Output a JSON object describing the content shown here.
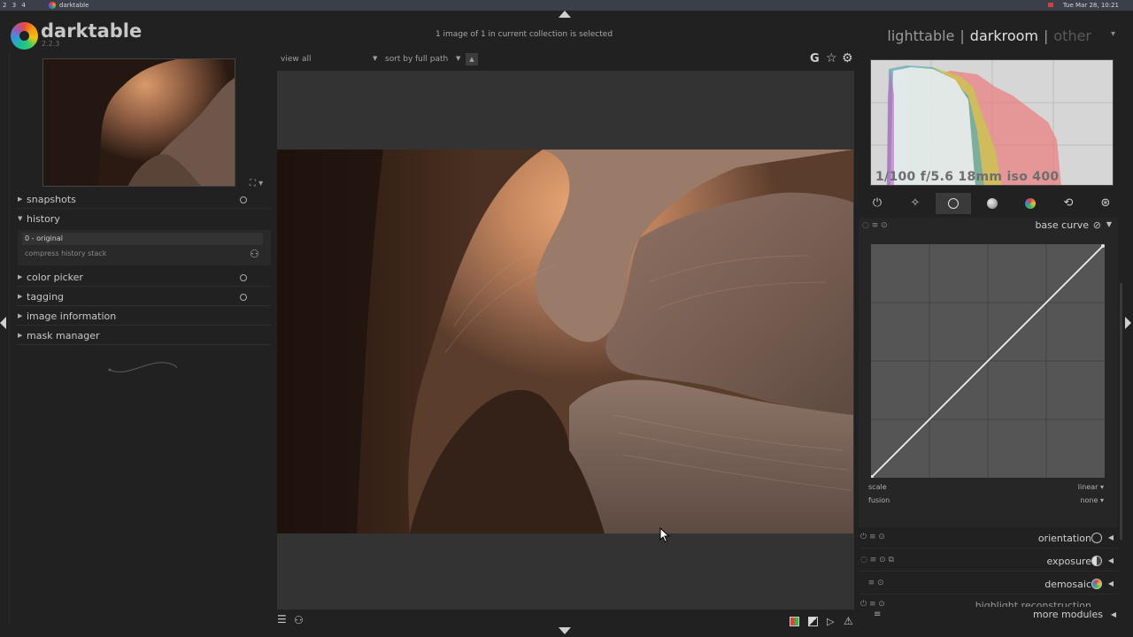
{
  "os": {
    "workspaces": [
      "2",
      "3",
      "4"
    ],
    "app_name": "darktable",
    "clock": "Tue Mar 28, 10:21"
  },
  "header": {
    "title": "darktable",
    "version": "2.2.3",
    "collection_info": "1 image of 1 in current collection is selected",
    "views": {
      "lighttable": "lighttable",
      "darkroom": "darkroom",
      "other": "other",
      "separator": "|"
    }
  },
  "left_panel": {
    "modules": [
      {
        "label": "snapshots",
        "expanded": false
      },
      {
        "label": "history",
        "expanded": true
      },
      {
        "label": "color picker",
        "expanded": false
      },
      {
        "label": "tagging",
        "expanded": false
      },
      {
        "label": "image information",
        "expanded": false
      },
      {
        "label": "mask manager",
        "expanded": false
      }
    ],
    "history": {
      "items": [
        "0 - original"
      ],
      "compress_label": "compress history stack"
    }
  },
  "toolbar": {
    "view_label": "view",
    "view_value": "all",
    "sort_label": "sort by",
    "sort_value": "full path",
    "grouping_label": "G"
  },
  "right_panel": {
    "exif_info": "1/100 f/5.6 18mm iso 400",
    "active_group": 2,
    "active_module": {
      "name": "base curve",
      "scale_label": "scale",
      "scale_value": "linear",
      "fusion_label": "fusion",
      "fusion_value": "none"
    },
    "modules": [
      {
        "name": "orientation"
      },
      {
        "name": "exposure"
      },
      {
        "name": "demosaic"
      },
      {
        "name": "highlight reconstruction"
      }
    ],
    "more_modules": "more modules"
  },
  "colors": {
    "background": "#212121",
    "canvas": "#333333",
    "text": "#c8c8c8",
    "accent_active": "#e0e0e0"
  }
}
